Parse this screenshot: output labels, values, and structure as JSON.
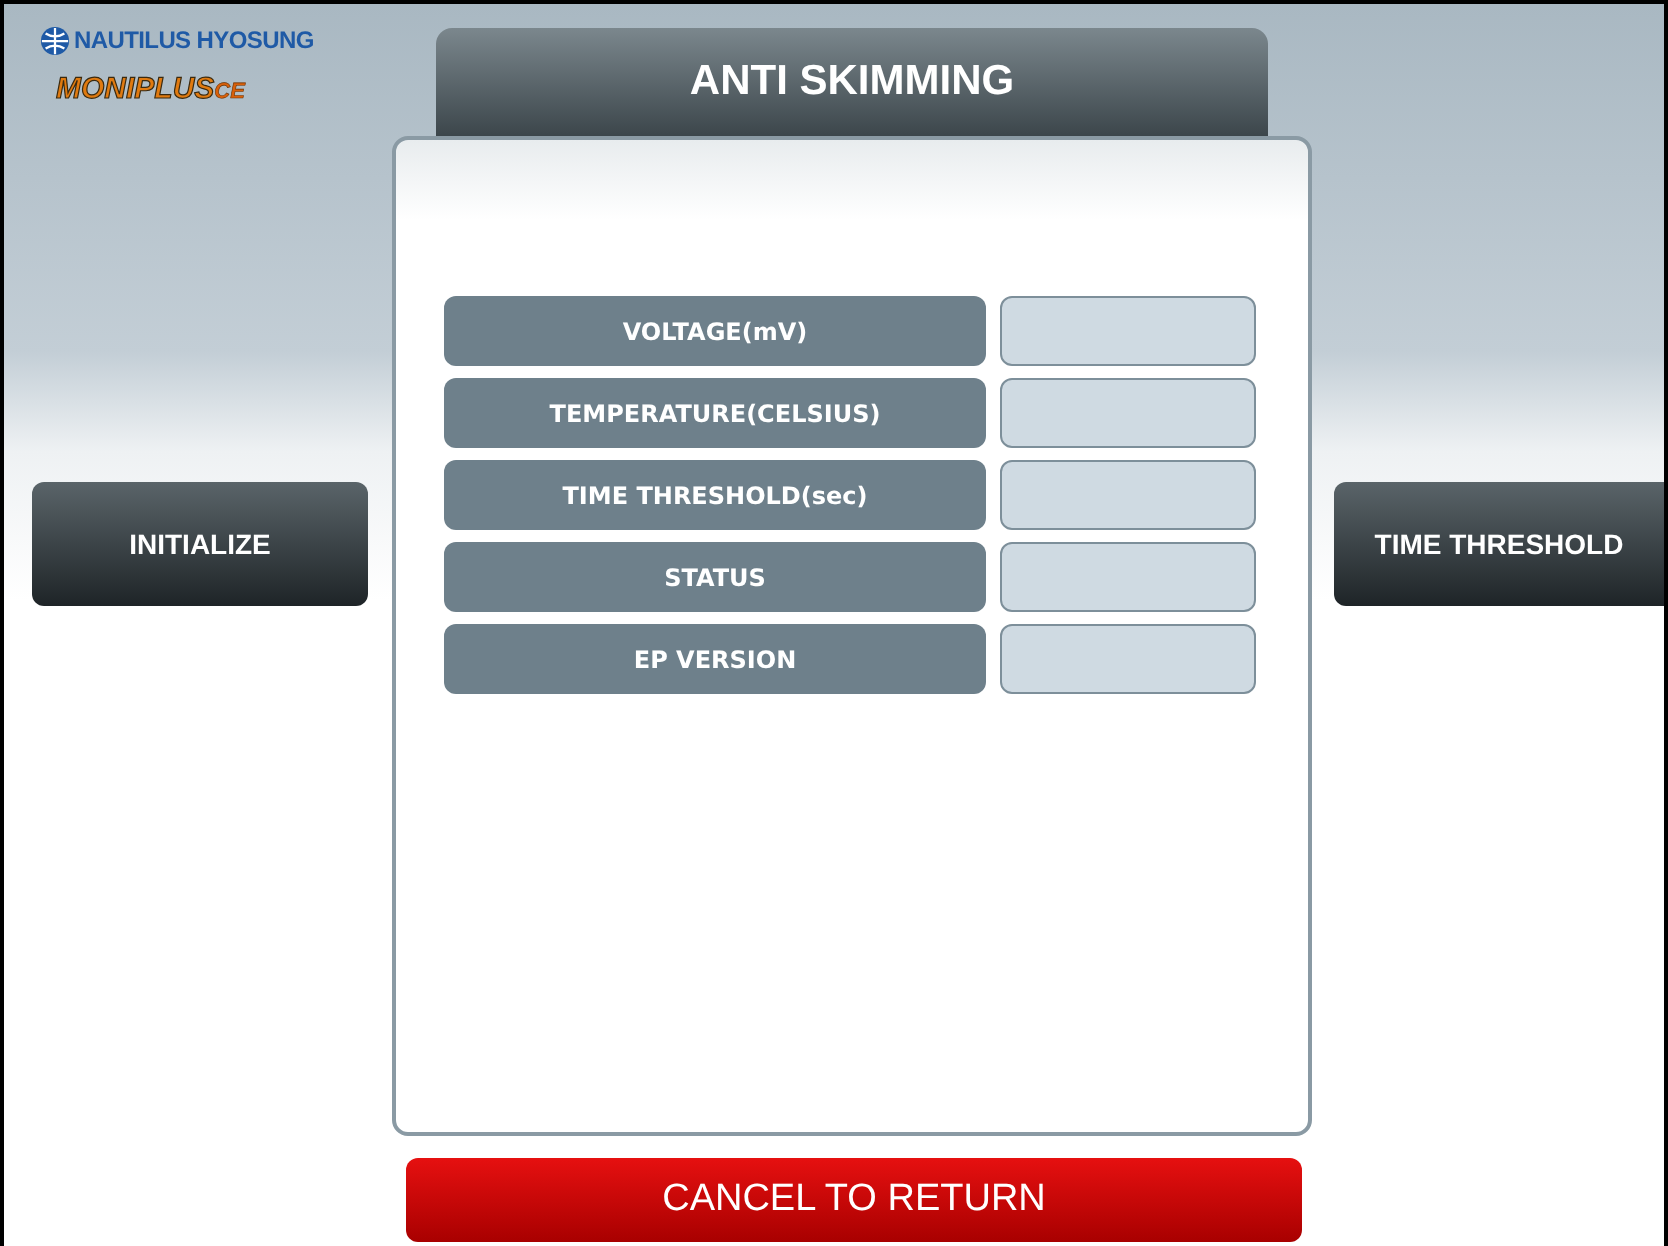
{
  "logo": {
    "company": "NAUTILUS HYOSUNG",
    "product": "MONIPLUS",
    "edition": "CE"
  },
  "title": "ANTI SKIMMING",
  "side_buttons": {
    "left": "INITIALIZE",
    "right": "TIME THRESHOLD"
  },
  "fields": [
    {
      "label": "VOLTAGE(mV)"
    },
    {
      "label": "TEMPERATURE(CELSIUS)"
    },
    {
      "label": "TIME THRESHOLD(sec)"
    },
    {
      "label": "STATUS"
    },
    {
      "label": "EP VERSION"
    }
  ],
  "cancel_button": "CANCEL TO RETURN"
}
